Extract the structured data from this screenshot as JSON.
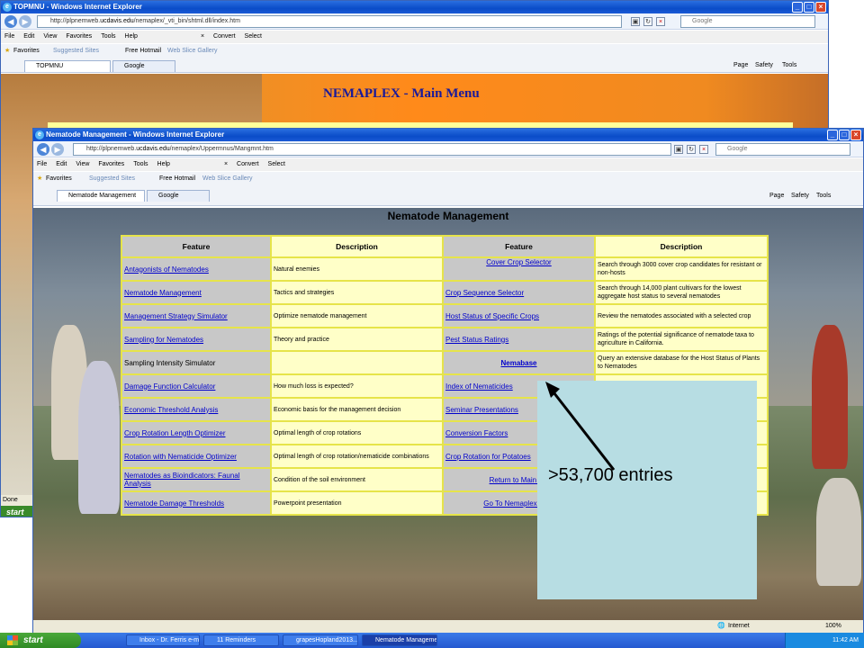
{
  "back_window": {
    "title": "TOPMNU - Windows Internet Explorer",
    "url_prefix": "http://plpnemweb.",
    "url_host": "ucdavis.edu",
    "url_path": "/nemaplex/_vti_bin/shtml.dll/index.htm",
    "search_placeholder": "Google",
    "menu": [
      "File",
      "Edit",
      "View",
      "Favorites",
      "Tools",
      "Help"
    ],
    "toolbar_convert": "Convert",
    "toolbar_select": "Select",
    "favorites_label": "Favorites",
    "favorites_links": [
      "Suggested Sites",
      "Free Hotmail",
      "Web Slice Gallery"
    ],
    "tabs": [
      "TOPMNU",
      "Google"
    ],
    "commands": [
      "Page",
      "Safety",
      "Tools"
    ],
    "page_title": "NEMAPLEX - Main Menu",
    "status": "Done",
    "start_label": "start"
  },
  "front_window": {
    "title": "Nematode Management - Windows Internet Explorer",
    "url_prefix": "http://plpnemweb.",
    "url_host": "ucdavis.edu",
    "url_path": "/nemaplex/Uppermnus/Mangmnt.htm",
    "search_placeholder": "Google",
    "menu": [
      "File",
      "Edit",
      "View",
      "Favorites",
      "Tools",
      "Help"
    ],
    "toolbar_convert": "Convert",
    "toolbar_select": "Select",
    "favorites_label": "Favorites",
    "favorites_links": [
      "Suggested Sites",
      "Free Hotmail",
      "Web Slice Gallery"
    ],
    "tabs": [
      "Nematode Management",
      "Google"
    ],
    "commands": [
      "Page",
      "Safety",
      "Tools"
    ],
    "page_title": "Nematode Management",
    "zone": "Internet",
    "zoom": "100%"
  },
  "table": {
    "headers": [
      "Feature",
      "Description",
      "Feature",
      "Description"
    ],
    "rows": [
      {
        "f1": "Antagonists of Nematodes",
        "d1": "Natural enemies",
        "f2": "Cover Crop Selector",
        "d2": "Search through 3000 cover crop candidates for resistant or non-hosts"
      },
      {
        "f1": "Nematode Management",
        "d1": "Tactics and strategies",
        "f2": "Crop Sequence Selector",
        "d2": "Search through 14,000 plant cultivars for the lowest aggregate host status to several nematodes"
      },
      {
        "f1": "Management Strategy Simulator",
        "d1": "Optimize nematode management",
        "f2": "Host Status of Specific Crops",
        "d2": "Review the nematodes associated with a selected crop"
      },
      {
        "f1": "Sampling for Nematodes",
        "d1": "Theory and practice",
        "f2": "Pest Status Ratings",
        "d2": "Ratings of the potential significance of nematode taxa to agriculture in California."
      },
      {
        "f1": "Sampling Intensity Simulator",
        "d1": "",
        "f2": "Nemabase",
        "d2": "Query an extensive database for the Host Status of Plants to Nematodes"
      },
      {
        "f1": "Damage Function Calculator",
        "d1": "How much loss is expected?",
        "f2": "Index of Nematicides",
        "d2": ""
      },
      {
        "f1": "Economic Threshold Analysis",
        "d1": "Economic basis for the management decision",
        "f2": "Seminar Presentations",
        "d2": ""
      },
      {
        "f1": "Crop Rotation Length Optimizer",
        "d1": "Optimal length of crop rotations",
        "f2": "Conversion Factors",
        "d2": ""
      },
      {
        "f1": "Rotation with Nematicide Optimizer",
        "d1": "Optimal length of crop rotation/nematicide combinations",
        "f2": "Crop Rotation for Potatoes",
        "d2": ""
      },
      {
        "f1": "Nematodes as Bioindicators: Faunal Analysis",
        "d1": "Condition of the soil environment",
        "f2": "Return to Main Me",
        "d2": ""
      },
      {
        "f1": "Nematode Damage Thresholds",
        "d1": "Powerpoint presentation",
        "f2": "Go To Nemaplex Hom",
        "d2": ""
      }
    ]
  },
  "callout": {
    "text": ">53,700 entries"
  },
  "taskbar": {
    "start": "start",
    "items": [
      "Inbox - Dr. Ferris e-m...",
      "11 Reminders",
      "grapesHopland2013....",
      "Nematode Manageme..."
    ],
    "clock": "11:42 AM"
  },
  "colors": {
    "link": "#0000cc",
    "table_bg": "#ffffc8",
    "table_border": "#e6e44a",
    "header_gray": "#c8c8c8",
    "callout_bg": "#b7dde3",
    "title_blue": "#1a1a9a"
  }
}
